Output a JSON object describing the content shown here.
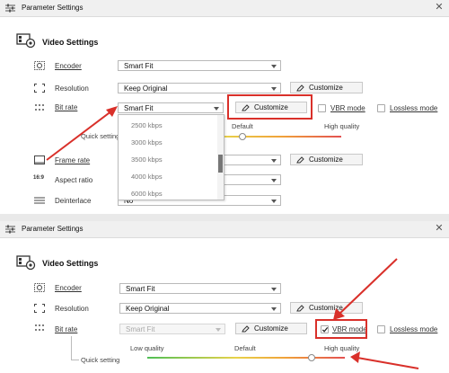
{
  "top": {
    "title": "Parameter Settings",
    "section": "Video Settings",
    "encoder": {
      "label": "Encoder",
      "value": "Smart Fit"
    },
    "resolution": {
      "label": "Resolution",
      "value": "Keep Original",
      "customize": "Customize"
    },
    "bitrate": {
      "label": "Bit rate",
      "value": "Smart Fit",
      "customize": "Customize"
    },
    "vbr": "VBR mode",
    "lossless": "Lossless mode",
    "quick": {
      "label": "Quick setting",
      "default": "Default",
      "high": "High quality"
    },
    "dropdown_items": [
      "2500 kbps",
      "3000 kbps",
      "3500 kbps",
      "4000 kbps",
      "6000 kbps"
    ],
    "framerate": {
      "label": "Frame rate",
      "customize": "Customize"
    },
    "aspect": {
      "label": "Aspect ratio"
    },
    "deinterlace": {
      "label": "Deinterlace",
      "value": "No"
    }
  },
  "bottom": {
    "title": "Parameter Settings",
    "section": "Video Settings",
    "encoder": {
      "label": "Encoder",
      "value": "Smart Fit"
    },
    "resolution": {
      "label": "Resolution",
      "value": "Keep Original",
      "customize": "Customize"
    },
    "bitrate": {
      "label": "Bit rate",
      "value": "Smart Fit",
      "customize": "Customize"
    },
    "vbr": "VBR mode",
    "vbr_checked": true,
    "lossless": "Lossless mode",
    "quick": {
      "label": "Quick setting",
      "low": "Low quality",
      "default": "Default",
      "high": "High quality",
      "level": 0.83
    }
  },
  "icons": {
    "close": "close-icon",
    "settings": "settings-icon",
    "pencil": "pencil-icon",
    "check": "check-icon"
  },
  "colors": {
    "annotation": "#d9302a",
    "slider_low": "#4fbf55",
    "slider_high": "#e35151"
  }
}
